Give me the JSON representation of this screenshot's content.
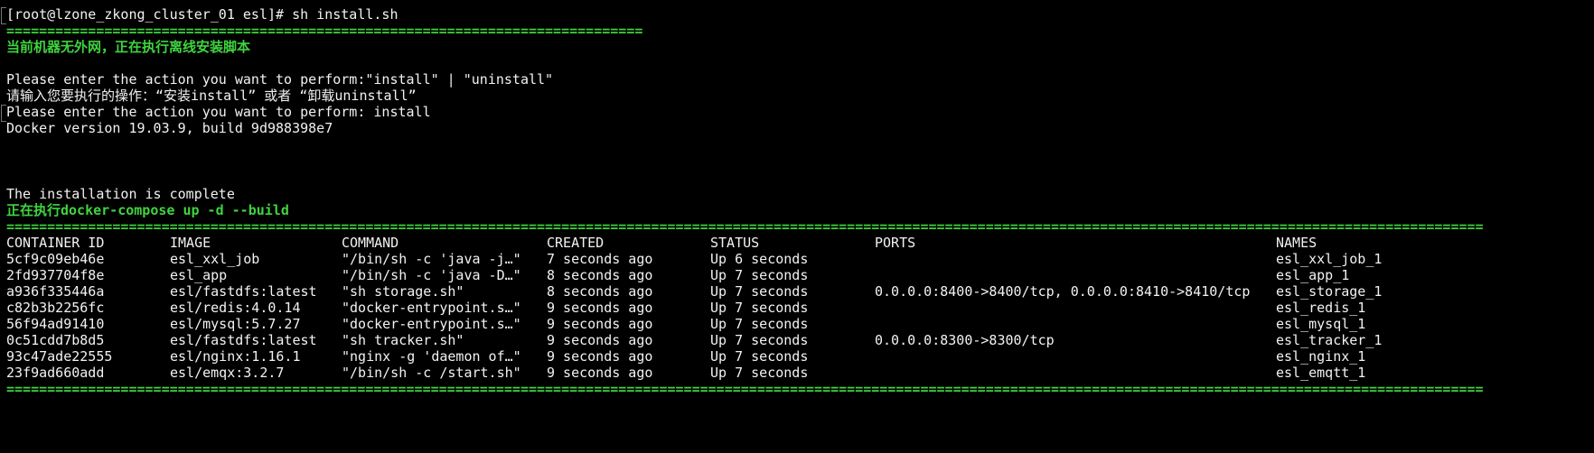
{
  "prompt_line": "[root@lzone_zkong_cluster_01 esl]# sh install.sh",
  "separator_short": "==============================================================================",
  "notice_offline": "当前机器无外网，正在执行离线安装脚本",
  "prompt_action_en": "Please enter the action you want to perform:\"install\" | \"uninstall\"",
  "prompt_action_cn": "请输入您要执行的操作：“安装install” 或者 “卸载uninstall”",
  "action_input": "Please enter the action you want to perform: install",
  "docker_version": "Docker version 19.03.9, build 9d988398e7",
  "install_complete": "The installation is complete",
  "compose_running": "正在执行docker-compose up -d --build",
  "separator_long": "=====================================================================================================================================================================================",
  "table": {
    "headers": {
      "container_id": "CONTAINER ID",
      "image": "IMAGE",
      "command": "COMMAND",
      "created": "CREATED",
      "status": "STATUS",
      "ports": "PORTS",
      "names": "NAMES"
    },
    "rows": [
      {
        "container_id": "5cf9c09eb46e",
        "image": "esl_xxl_job",
        "command": "\"/bin/sh -c 'java -j…\"",
        "created": "7 seconds ago",
        "status": "Up 6 seconds",
        "ports": "",
        "names": "esl_xxl_job_1"
      },
      {
        "container_id": "2fd937704f8e",
        "image": "esl_app",
        "command": "\"/bin/sh -c 'java -D…\"",
        "created": "8 seconds ago",
        "status": "Up 7 seconds",
        "ports": "",
        "names": "esl_app_1"
      },
      {
        "container_id": "a936f335446a",
        "image": "esl/fastdfs:latest",
        "command": "\"sh storage.sh\"",
        "created": "8 seconds ago",
        "status": "Up 7 seconds",
        "ports": "0.0.0.0:8400->8400/tcp, 0.0.0.0:8410->8410/tcp",
        "names": "esl_storage_1"
      },
      {
        "container_id": "c82b3b2256fc",
        "image": "esl/redis:4.0.14",
        "command": "\"docker-entrypoint.s…\"",
        "created": "9 seconds ago",
        "status": "Up 7 seconds",
        "ports": "",
        "names": "esl_redis_1"
      },
      {
        "container_id": "56f94ad91410",
        "image": "esl/mysql:5.7.27",
        "command": "\"docker-entrypoint.s…\"",
        "created": "9 seconds ago",
        "status": "Up 7 seconds",
        "ports": "",
        "names": "esl_mysql_1"
      },
      {
        "container_id": "0c51cdd7b8d5",
        "image": "esl/fastdfs:latest",
        "command": "\"sh tracker.sh\"",
        "created": "9 seconds ago",
        "status": "Up 7 seconds",
        "ports": "0.0.0.0:8300->8300/tcp",
        "names": "esl_tracker_1"
      },
      {
        "container_id": "93c47ade22555",
        "image": "esl/nginx:1.16.1",
        "command": "\"nginx -g 'daemon of…\"",
        "created": "9 seconds ago",
        "status": "Up 7 seconds",
        "ports": "",
        "names": "esl_nginx_1"
      },
      {
        "container_id": "23f9ad660add",
        "image": "esl/emqx:3.2.7",
        "command": "\"/bin/sh -c /start.sh\"",
        "created": "9 seconds ago",
        "status": "Up 7 seconds",
        "ports": "",
        "names": "esl_emqtt_1"
      }
    ]
  },
  "colors": {
    "background": "#000000",
    "foreground": "#f2f2f2",
    "accent_green": "#3fd33f"
  }
}
